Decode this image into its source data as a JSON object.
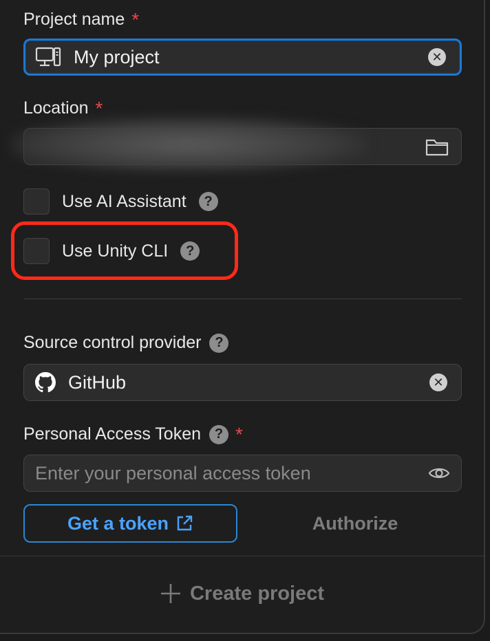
{
  "project_name": {
    "label": "Project name",
    "required_mark": "*",
    "value": "My project",
    "icon": "computer-icon"
  },
  "location": {
    "label": "Location",
    "required_mark": "*",
    "value_obscured": true,
    "icon": "folder-icon"
  },
  "options": {
    "ai_assistant_label": "Use AI Assistant",
    "ai_assistant_checked": false,
    "unity_cli_label": "Use Unity CLI",
    "unity_cli_checked": false,
    "help_glyph": "?"
  },
  "highlight_color": "#ff2a1a",
  "source_control": {
    "label": "Source control provider",
    "value": "GitHub",
    "icon": "github-icon"
  },
  "token": {
    "label": "Personal Access Token",
    "required_mark": "*",
    "placeholder": "Enter your personal access token",
    "icon": "eye-icon"
  },
  "buttons": {
    "get_token": "Get a token",
    "authorize": "Authorize",
    "create_project": "Create project"
  },
  "colors": {
    "accent": "#1f78d1",
    "link": "#4aa3ff",
    "required": "#e5484d",
    "background": "#1e1e1e"
  }
}
